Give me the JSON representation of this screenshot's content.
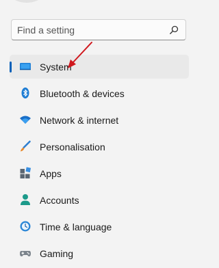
{
  "search": {
    "placeholder": "Find a setting",
    "icon": "search-icon"
  },
  "nav": {
    "items": [
      {
        "label": "System",
        "icon": "system-display-icon",
        "selected": true
      },
      {
        "label": "Bluetooth & devices",
        "icon": "bluetooth-icon"
      },
      {
        "label": "Network & internet",
        "icon": "wifi-icon"
      },
      {
        "label": "Personalisation",
        "icon": "brush-icon"
      },
      {
        "label": "Apps",
        "icon": "apps-icon"
      },
      {
        "label": "Accounts",
        "icon": "accounts-icon"
      },
      {
        "label": "Time & language",
        "icon": "time-language-icon"
      },
      {
        "label": "Gaming",
        "icon": "gamepad-icon"
      }
    ]
  },
  "colors": {
    "accent": "#005fb8",
    "annotation_arrow": "#d0181e",
    "selected_bg": "#e9e9e9"
  }
}
